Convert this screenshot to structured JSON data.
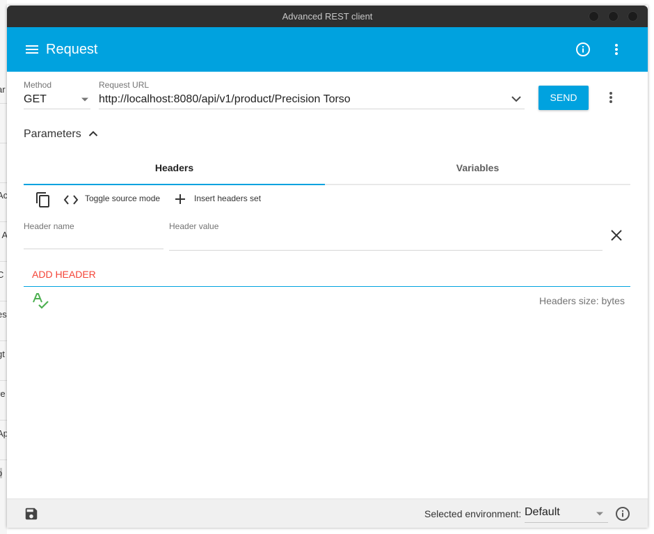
{
  "window": {
    "title": "Advanced REST client"
  },
  "appbar": {
    "title": "Request"
  },
  "request": {
    "method_label": "Method",
    "method_value": "GET",
    "url_label": "Request URL",
    "url_value": "http://localhost:8080/api/v1/product/Precision Torso",
    "send_label": "SEND"
  },
  "parameters": {
    "label": "Parameters"
  },
  "tabs": [
    {
      "label": "Headers",
      "active": true
    },
    {
      "label": "Variables",
      "active": false
    }
  ],
  "toolbar": {
    "toggle_source_label": "Toggle source mode",
    "insert_headers_label": "Insert headers set"
  },
  "header_form": {
    "name_label": "Header name",
    "value_label": "Header value",
    "add_header_label": "ADD HEADER",
    "size_text": "Headers size: bytes"
  },
  "footer": {
    "env_label": "Selected environment:",
    "env_value": "Default"
  },
  "background_window": {
    "fragments": [
      "ar",
      "Ac",
      "t A",
      "C",
      "es",
      "gt",
      "re",
      "Ap",
      "o"
    ]
  },
  "colors": {
    "accent": "#00a2df",
    "danger": "#f44336",
    "spellcheck": "#4caf50",
    "titlebar": "#2f2f2f"
  }
}
